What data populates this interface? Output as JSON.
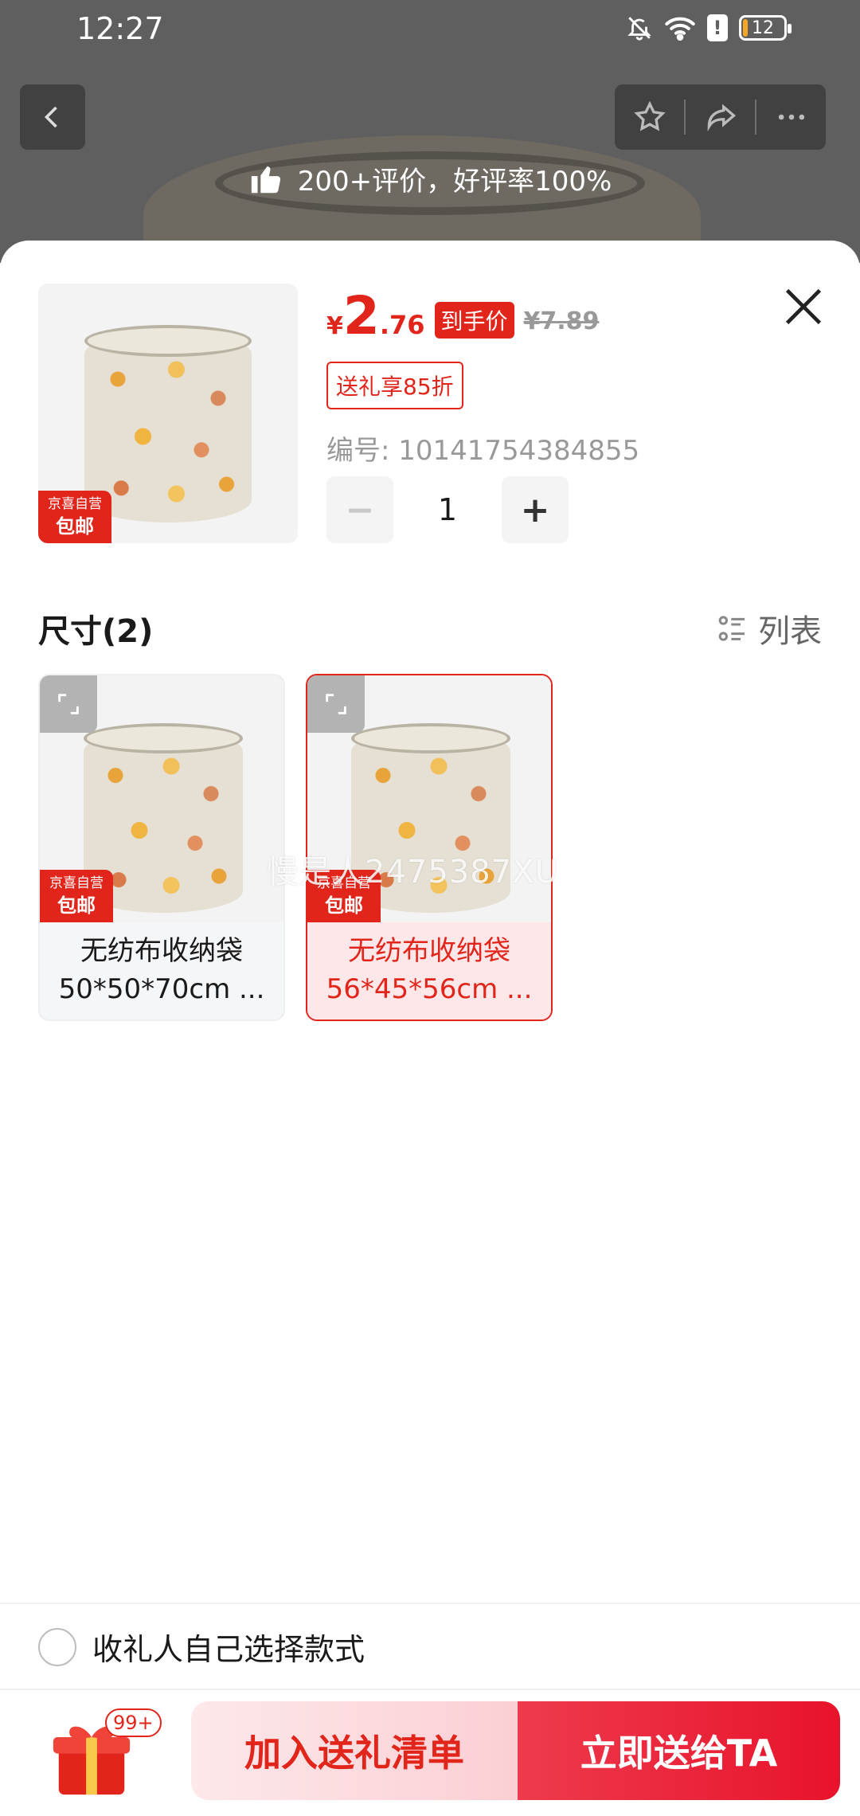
{
  "status_bar": {
    "time": "12:27",
    "battery": "12"
  },
  "banner": {
    "review_text": "200+评价，好评率100%"
  },
  "product": {
    "price_yen": "¥",
    "price_int": "2",
    "price_dec": ".76",
    "price_tag": "到手价",
    "original_price": "¥7.89",
    "gift_discount": "送礼享85折",
    "sku_code": "编号: 10141754384855",
    "quantity": "1",
    "badge_top": "京喜自营",
    "badge_bottom": "包邮"
  },
  "stepper": {
    "minus": "−",
    "plus": "+"
  },
  "size_section": {
    "title": "尺寸(2)",
    "list_toggle": "列表",
    "options": [
      {
        "line1": "无纺布收纳袋",
        "line2": "50*50*70cm ...",
        "selected": false
      },
      {
        "line1": "无纺布收纳袋",
        "line2": "56*45*56cm ...",
        "selected": true
      }
    ]
  },
  "watermark": "慢是人2475387XU",
  "footer": {
    "self_choose": "收礼人自己选择款式",
    "cart_badge": "99+",
    "add_button": "加入送礼清单",
    "send_button": "立即送给TA"
  },
  "colors": {
    "accent": "#e1251b",
    "overlay": "#5f5f5f"
  }
}
